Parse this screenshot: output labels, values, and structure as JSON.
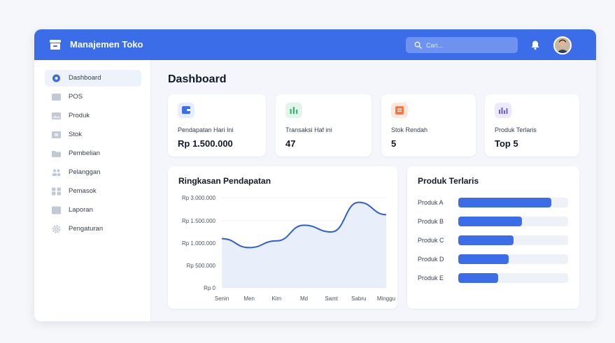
{
  "app": {
    "title": "Manajemen Toko"
  },
  "search": {
    "placeholder": "Cari..."
  },
  "colors": {
    "accent": "#3b6de8",
    "card_bg": "#ffffff",
    "bar_track": "#eef1f7"
  },
  "sidebar": {
    "active": "Dashboard",
    "items": [
      {
        "label": "Dashboard",
        "icon": "dashboard-icon"
      },
      {
        "label": "POS",
        "icon": "pos-icon"
      },
      {
        "label": "Produk",
        "icon": "product-icon"
      },
      {
        "label": "Stok",
        "icon": "stock-icon"
      },
      {
        "label": "Pembelian",
        "icon": "folder-icon"
      },
      {
        "label": "Pelanggan",
        "icon": "users-icon"
      },
      {
        "label": "Pemasok",
        "icon": "supplier-icon"
      },
      {
        "label": "Laporan",
        "icon": "report-icon"
      },
      {
        "label": "Pengaturan",
        "icon": "gear-icon"
      }
    ]
  },
  "page": {
    "title": "Dashboard"
  },
  "stats": [
    {
      "label": "Pendapatan Hari Ini",
      "value": "Rp 1.500.000",
      "icon": "wallet-icon",
      "color": "#3b6de8",
      "bg": "#e6edfc"
    },
    {
      "label": "Transaksi Haf ini",
      "value": "47",
      "icon": "bar-chart-icon",
      "color": "#35b46a",
      "bg": "#e3f5ea"
    },
    {
      "label": "Stok Rendah",
      "value": "5",
      "icon": "box-icon",
      "color": "#ee7b43",
      "bg": "#fde7dc"
    },
    {
      "label": "Produk Terlaris",
      "value": "Top 5",
      "icon": "trending-chart-icon",
      "color": "#6e5bd8",
      "bg": "#ece9fb"
    }
  ],
  "revenue": {
    "title": "Ringkasan Pendapatan",
    "chart_data": {
      "type": "area",
      "title": "Ringkasan Pendapatan",
      "y_tick_labels": [
        "Rp 3.000.000",
        "Rp 1.500.000",
        "Rp 1.000.000",
        "Rp 500.000",
        "Rp 0"
      ],
      "categories": [
        "Senin",
        "Men",
        "Kim",
        "Md",
        "Samt",
        "Sabru",
        "Minggu"
      ],
      "values": [
        1100000,
        900000,
        1050000,
        1400000,
        1250000,
        2700000,
        1900000
      ],
      "grid": true,
      "line_color": "#2f5fcc",
      "fill_color": "#e9eefb"
    }
  },
  "top_products": {
    "title": "Produk Terlaris",
    "chart_data": {
      "type": "bar",
      "orientation": "horizontal",
      "title": "Produk Terlaris",
      "categories": [
        "Produk A",
        "Produk B",
        "Produk C",
        "Produk D",
        "Produk E"
      ],
      "values": [
        0.85,
        0.58,
        0.5,
        0.46,
        0.36
      ],
      "scale": [
        0,
        1
      ]
    }
  }
}
